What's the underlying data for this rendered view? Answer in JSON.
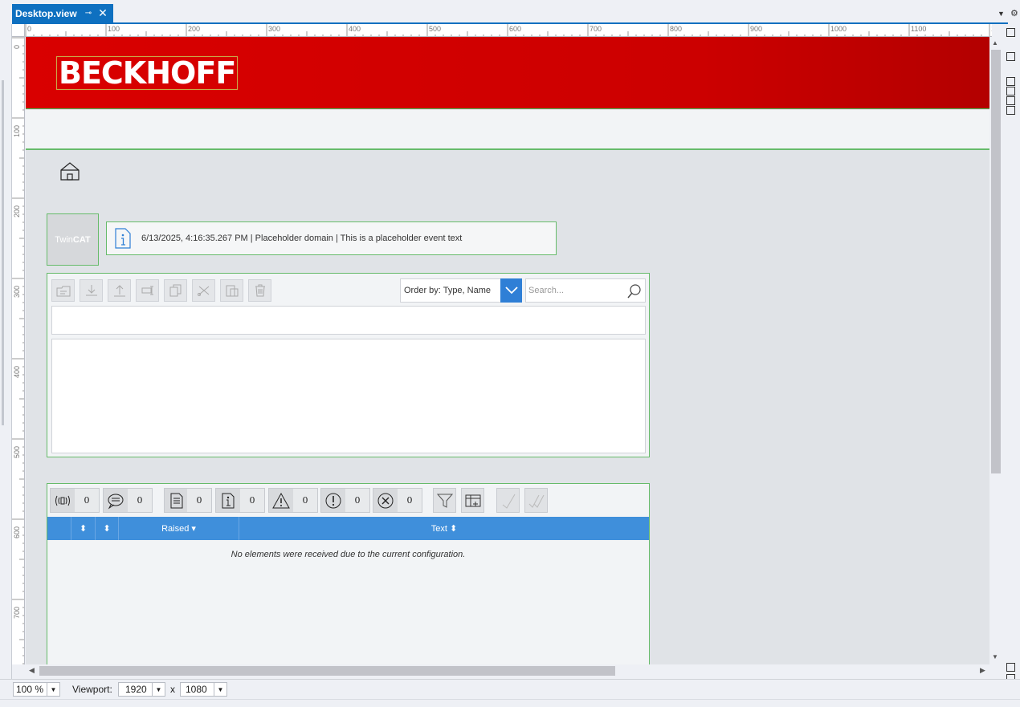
{
  "tab": {
    "title": "Desktop.view",
    "pin_glyph": "⊸",
    "close_glyph": "✕"
  },
  "rulers": {
    "top": [
      "0",
      "100",
      "200",
      "300",
      "400",
      "500",
      "600",
      "700",
      "800",
      "900",
      "1000",
      "1100",
      "120"
    ],
    "left": [
      "0",
      "100",
      "200",
      "300",
      "400",
      "500",
      "600",
      "700"
    ]
  },
  "header": {
    "logo_text": "BECKHOFF"
  },
  "twincat_logo": {
    "part1": "Twin",
    "part2": "CAT"
  },
  "event_line": {
    "text": "6/13/2025, 4:16:35.267 PM | Placeholder domain | This is a placeholder event text"
  },
  "file_panel": {
    "order_by": "Order by: Type, Name",
    "search_placeholder": "Search..."
  },
  "event_grid": {
    "filters": [
      {
        "name": "connection",
        "count": "0"
      },
      {
        "name": "message",
        "count": "0"
      },
      {
        "name": "verbose",
        "count": "0"
      },
      {
        "name": "info",
        "count": "0"
      },
      {
        "name": "warning",
        "count": "0"
      },
      {
        "name": "error",
        "count": "0"
      },
      {
        "name": "critical",
        "count": "0"
      }
    ],
    "columns": {
      "raised": "Raised ▾",
      "text": "Text ⬍",
      "sort1": "⬍",
      "sort2": "⬍"
    },
    "empty_text": "No elements were received due to the current configuration."
  },
  "status": {
    "zoom": "100 %",
    "viewport_label": "Viewport:",
    "width": "1920",
    "x": "x",
    "height": "1080"
  },
  "colors": {
    "accent": "#0e70c0",
    "header_red": "#cc0000",
    "grid_header": "#3f8fdb",
    "frame_green": "#66bb6a"
  }
}
